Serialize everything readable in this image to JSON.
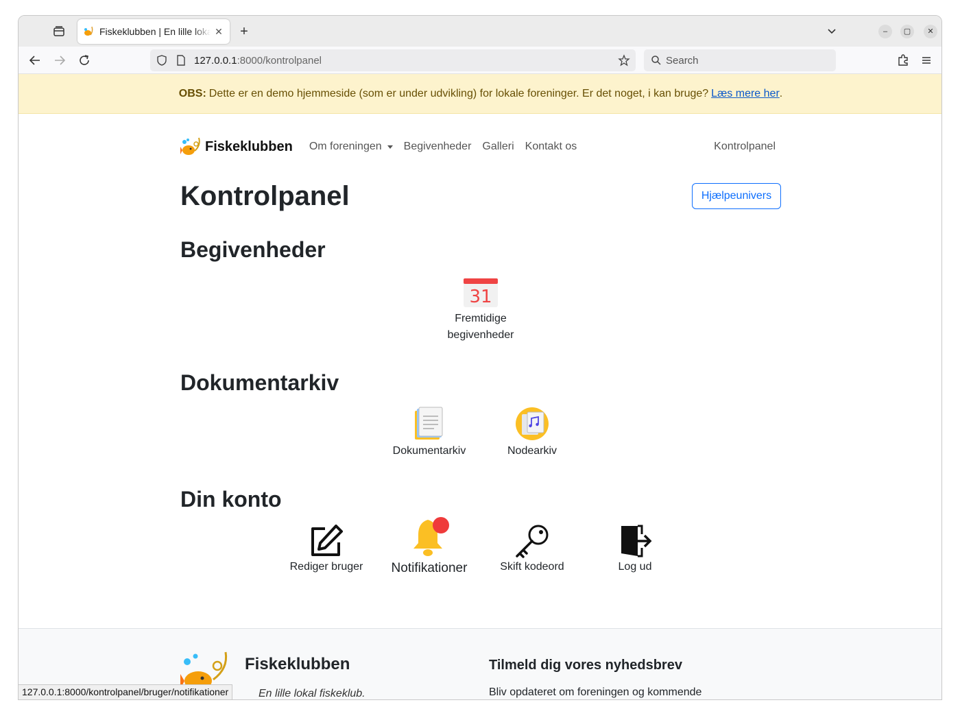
{
  "browser": {
    "tab_title": "Fiskeklubben | En lille lokal fiskeklub",
    "url_host": "127.0.0.1",
    "url_path": ":8000/kontrolpanel",
    "search_placeholder": "Search",
    "status_url": "127.0.0.1:8000/kontrolpanel/bruger/notifikationer"
  },
  "alert": {
    "label": "OBS:",
    "text": "Dette er en demo hjemmeside (som er under udvikling) for lokale foreninger. Er det noget, i kan bruge?",
    "link": "Læs mere her",
    "end": "."
  },
  "nav": {
    "brand": "Fiskeklubben",
    "items": [
      "Om foreningen",
      "Begivenheder",
      "Galleri",
      "Kontakt os"
    ],
    "right": "Kontrolpanel"
  },
  "page": {
    "title": "Kontrolpanel",
    "help_button": "Hjælpeunivers"
  },
  "sections": {
    "events": {
      "heading": "Begivenheder",
      "calendar_day": "31",
      "tiles": [
        {
          "line1": "Fremtidige",
          "line2": "begivenheder"
        }
      ]
    },
    "archive": {
      "heading": "Dokumentarkiv",
      "tiles": [
        "Dokumentarkiv",
        "Nodearkiv"
      ]
    },
    "account": {
      "heading": "Din konto",
      "tiles": [
        "Rediger bruger",
        "Notifikationer",
        "Skift kodeord",
        "Log ud"
      ]
    }
  },
  "footer": {
    "name": "Fiskeklubben",
    "tagline": "En lille lokal fiskeklub.",
    "newsletter_title": "Tilmeld dig vores nyhedsbrev",
    "newsletter_text": "Bliv opdateret om foreningen og kommende"
  },
  "colors": {
    "primary": "#0d6efd",
    "alert_bg": "#fdf3cd",
    "alert_text": "#674f04",
    "notification_dot": "#ef3b3b",
    "bell": "#fbbf24"
  }
}
